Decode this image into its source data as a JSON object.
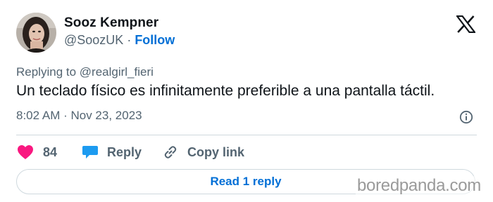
{
  "author": {
    "display_name": "Sooz Kempner",
    "handle": "@SoozUK",
    "separator": " · ",
    "follow_label": "Follow"
  },
  "tweet": {
    "replying_prefix": "Replying to ",
    "replying_to": "@realgirl_fieri",
    "text": "Un teclado físico es infinitamente preferible a una pantalla táctil.",
    "timestamp": "8:02 AM · Nov 23, 2023"
  },
  "actions": {
    "like_count": "84",
    "reply_label": "Reply",
    "copy_link_label": "Copy link"
  },
  "read_replies_label": "Read 1 reply",
  "watermark": "boredpanda.com",
  "colors": {
    "accent": "#006fd6",
    "like": "#f91880",
    "reply_icon": "#1d9bf0",
    "secondary_text": "#536471",
    "divider": "#cfd9de"
  },
  "icons": [
    "x-logo-icon",
    "info-icon",
    "heart-icon",
    "reply-bubble-icon",
    "link-icon"
  ]
}
